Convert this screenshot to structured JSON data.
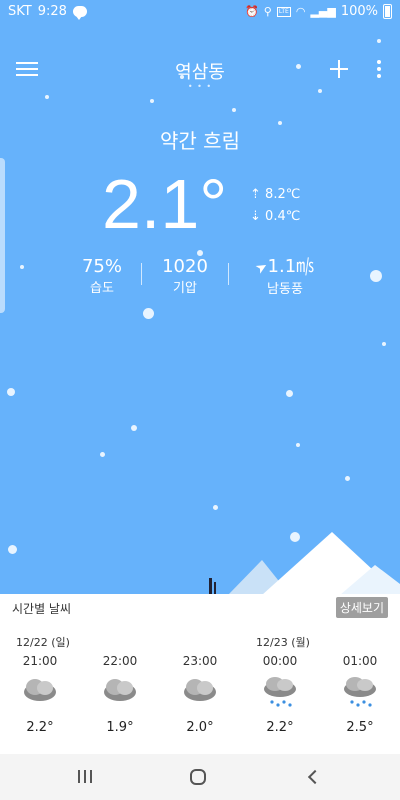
{
  "status": {
    "carrier": "SKT",
    "time": "9:28",
    "battery": "100%",
    "volte": "LTE\nVoLTE"
  },
  "header": {
    "location": "역삼동",
    "page_dots": "• • •"
  },
  "current": {
    "condition": "약간 흐림",
    "temperature": "2.1°",
    "high": "8.2℃",
    "low": "0.4℃",
    "humidity_value": "75%",
    "humidity_label": "습도",
    "pressure_value": "1020",
    "pressure_label": "기압",
    "wind_value": "1.1㎧",
    "wind_label": "남동풍"
  },
  "hourly": {
    "title": "시간별 날씨",
    "detail_button": "상세보기",
    "dates": [
      "12/22 (일)",
      "12/23 (월)"
    ],
    "items": [
      {
        "time": "21:00",
        "icon": "cloud-icon",
        "temp": "2.2°"
      },
      {
        "time": "22:00",
        "icon": "cloud-icon",
        "temp": "1.9°"
      },
      {
        "time": "23:00",
        "icon": "cloud-icon",
        "temp": "2.0°"
      },
      {
        "time": "00:00",
        "icon": "snow-cloud-icon",
        "temp": "2.2°"
      },
      {
        "time": "01:00",
        "icon": "snow-cloud-icon",
        "temp": "2.5°"
      }
    ]
  },
  "colors": {
    "sky": "#66b2fb",
    "panel": "#ffffff",
    "detail_button": "#9e9e9e"
  }
}
